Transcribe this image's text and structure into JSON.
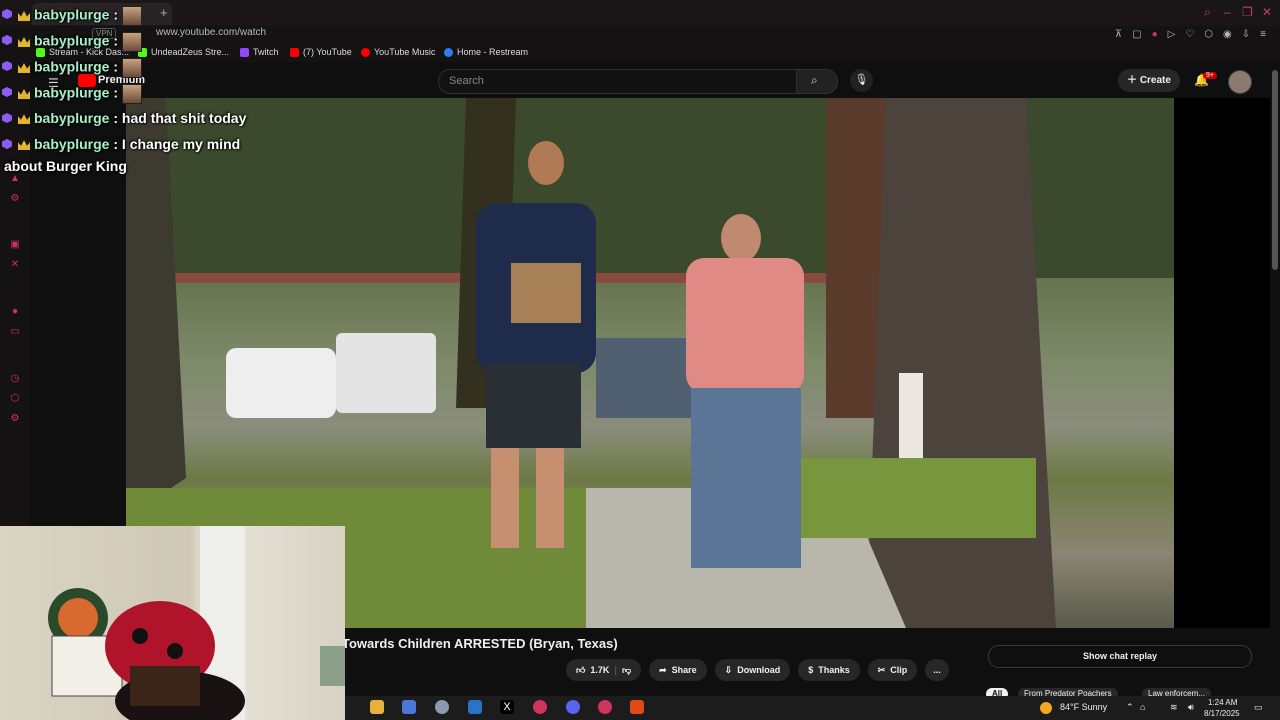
{
  "browser": {
    "tab_title": "babyplurge",
    "new_tab": "+",
    "url": "www.youtube.com/watch",
    "vpn_label": "VPN",
    "bookmarks": [
      {
        "label": "Stream - Kick Das...",
        "color": "#53fc18"
      },
      {
        "label": "UndeadZeus Stre...",
        "color": "#53fc18"
      },
      {
        "label": "Twitch",
        "color": "#9146ff"
      },
      {
        "label": "(7) YouTube",
        "color": "#ff0000"
      },
      {
        "label": "YouTube Music",
        "color": "#ff0000"
      },
      {
        "label": "Home - Restream",
        "color": "#2f7cf6"
      }
    ]
  },
  "youtube": {
    "logo_text": "Premium",
    "search_placeholder": "Search",
    "create_label": "Create",
    "notification_count": "9+",
    "video_title": "Towards Children ARRESTED (Bryan, Texas)",
    "likes": "1.7K",
    "share_label": "Share",
    "download_label": "Download",
    "thanks_label": "Thanks",
    "clip_label": "Clip",
    "more_label": "...",
    "chat_replay_label": "Show chat replay",
    "chip_all": "All",
    "chip_from": "From Predator Poachers",
    "chip_law": "Law enforcem..."
  },
  "chat": [
    {
      "user": "babyplurge",
      "text": ""
    },
    {
      "user": "babyplurge",
      "text": ""
    },
    {
      "user": "babyplurge",
      "text": ""
    },
    {
      "user": "babyplurge",
      "text": ""
    },
    {
      "user": "babyplurge",
      "text": "had that shit today"
    },
    {
      "user": "babyplurge",
      "text": "I change my mind"
    }
  ],
  "chat_continuation": "about Burger King",
  "taskbar": {
    "weather": "84°F  Sunny",
    "time": "1:24 AM",
    "date": "8/17/2025"
  },
  "colors": {
    "accent": "#d0345a",
    "chat_user": "#a6f0c6",
    "crown": "#e2b431"
  }
}
